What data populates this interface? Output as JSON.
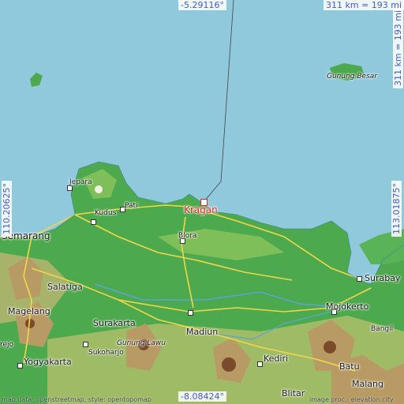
{
  "map": {
    "target_place": "Kragan",
    "colors": {
      "sea": "#8fc9db",
      "lowland": "#4da94d",
      "hill": "#b89b64",
      "mountain": "#7a4a2a",
      "road": "#f2d64a",
      "label_target": "#e2262b",
      "coord_text": "#4a58c8"
    },
    "coords": {
      "lat_top": "-5.29116°",
      "lat_bottom": "-8.08424°",
      "lon_left": "110.20625°",
      "lon_right": "113.01875°"
    },
    "scale": {
      "top": "311 km = 193 mi",
      "right": "311 km = 193 mi"
    },
    "places": {
      "jepara": "Jepara",
      "pati": "Pati",
      "kudus": "Kudus",
      "kragan": "Kragan",
      "blora": "Blora",
      "semarang": "Semarang",
      "salatiga": "Salatiga",
      "magelang": "Magelang",
      "surakarta": "Surakarta",
      "madiun": "Madiun",
      "gunung_lawu": "Gunung Lawu",
      "sukoharjo": "Sukoharjo",
      "yogyakarta": "Yogyakarta",
      "kediri": "Kediri",
      "batu": "Batu",
      "malang": "Malang",
      "blitar": "Blitar",
      "mojokerto": "Mojokerto",
      "surabaya": "Surabay",
      "bangil": "Bangil",
      "gunung_besar": "Gunung Besar",
      "tejo": "rejo"
    },
    "attribution": {
      "left": "map data: openstreetmap, style: opentopomap",
      "right": "image proc.: elevation.city"
    }
  }
}
